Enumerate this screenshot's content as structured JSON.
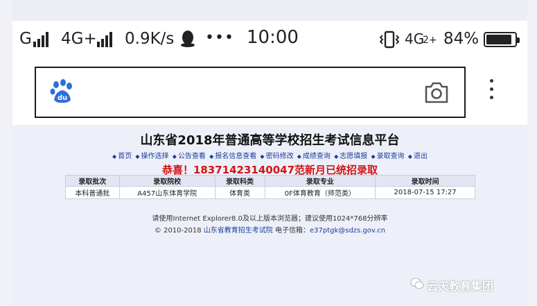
{
  "status_bar": {
    "carrier1": "G",
    "net2": "4G+",
    "speed": "0.9K/s",
    "dots": "•••",
    "time": "10:00",
    "net_right": "4G",
    "battery_pct": "84%",
    "battery_level": 0.84
  },
  "search": {
    "logo": "baidu-paw-icon",
    "camera": "camera-icon"
  },
  "page": {
    "title": "山东省2018年普通高等学校招生考试信息平台",
    "nav": [
      "首页",
      "操作选择",
      "公告查看",
      "报名信息查看",
      "密码修改",
      "成绩查询",
      "志愿填报",
      "录取查询",
      "退出"
    ],
    "congrats": "恭喜！18371423140047范新月已统招录取",
    "table": {
      "headers": [
        "录取批次",
        "录取院校",
        "录取科类",
        "录取专业",
        "录取时间"
      ],
      "row": [
        "本科普通批",
        "A457山东体育学院",
        "体育类",
        "0F体育教育（师范类）",
        "2018-07-15 17:27"
      ]
    },
    "footer_line1": "请使用Internet Explorer8.0及以上版本浏览器；建议使用1024*768分辨率",
    "footer_copyright": "© 2010-2018",
    "footer_org": "山东省教育招生考试院",
    "footer_email_label": "电子信箱：",
    "footer_email": "e37ptgk@sdzs.gov.cn"
  },
  "watermark": "云天教育集团",
  "colors": {
    "accent_red": "#d21414",
    "link_blue": "#1a3d9c",
    "baidu_blue": "#2e6fd8"
  }
}
